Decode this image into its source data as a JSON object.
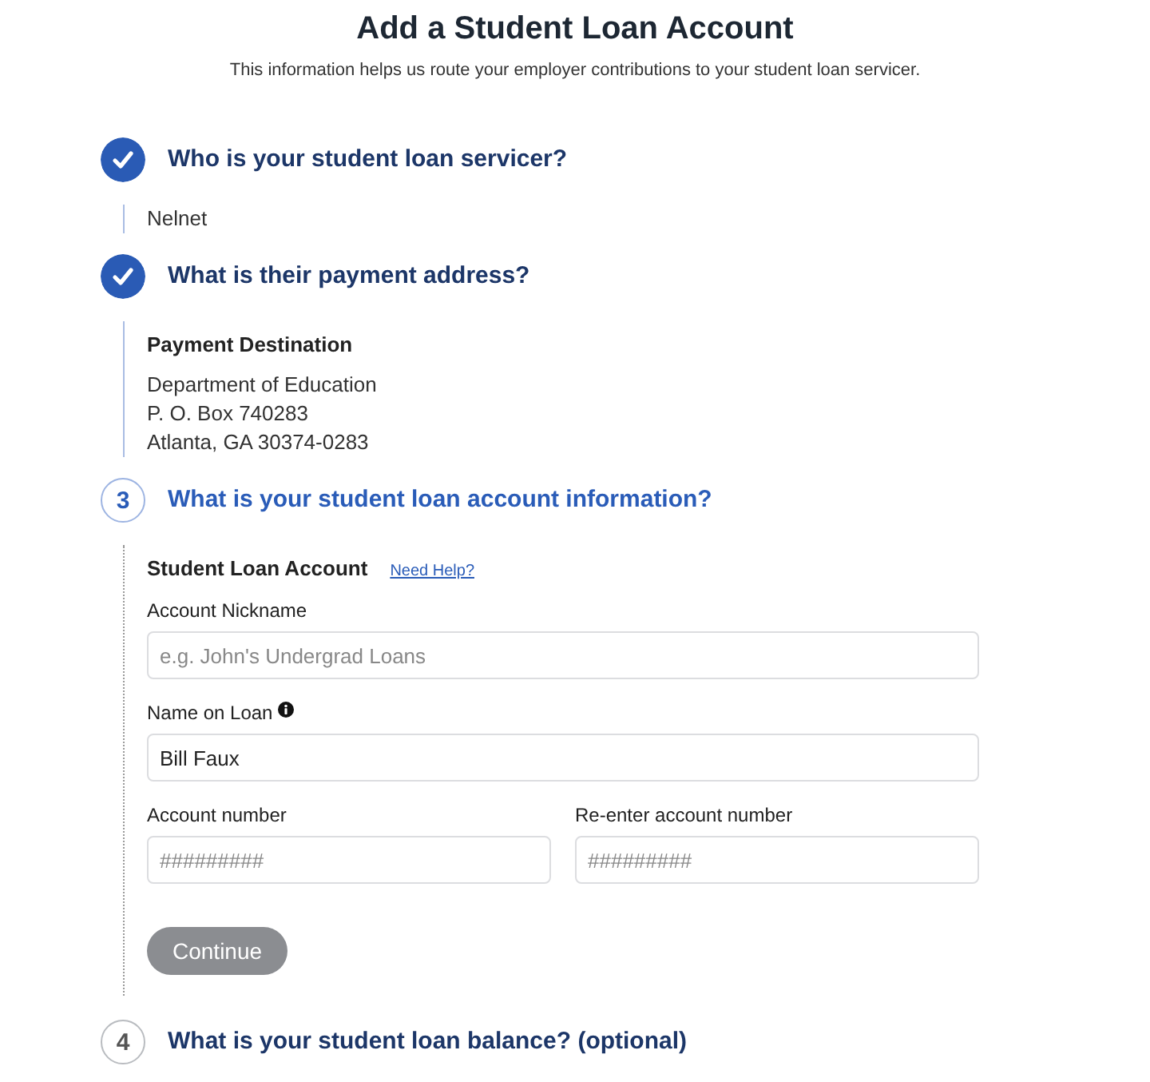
{
  "title": "Add a Student Loan Account",
  "subtitle": "This information helps us route your employer contributions to your student loan servicer.",
  "steps": [
    {
      "completed": true,
      "selected": false,
      "heading": "Who is your student loan servicer?",
      "summary": {
        "kind": "text",
        "text": "Nelnet"
      }
    },
    {
      "completed": true,
      "selected": false,
      "heading": "What is their payment address?",
      "summary": {
        "kind": "address",
        "label": "Payment Destination",
        "lines": [
          "Department of Education",
          "P. O. Box 740283",
          "Atlanta, GA 30374-0283"
        ]
      }
    },
    {
      "completed": false,
      "selected": true,
      "number": "3",
      "heading": "What is your student loan account information?",
      "form": {
        "title": "Student Loan Account",
        "help_link": "Need Help?",
        "rows": [
          {
            "fields": [
              {
                "label": "Account Nickname",
                "info": false,
                "placeholder": "e.g. John's Undergrad Loans"
              }
            ]
          },
          {
            "fields": [
              {
                "label": "Name on Loan",
                "info": true,
                "value": "Bill Faux"
              }
            ]
          },
          {
            "fields": [
              {
                "label": "Account number",
                "info": false,
                "placeholder": "#########"
              },
              {
                "label": "Re-enter account number",
                "info": false,
                "placeholder": "#########"
              }
            ]
          }
        ],
        "button": {
          "label": "Continue",
          "disabled": true
        }
      }
    },
    {
      "completed": false,
      "selected": false,
      "number": "4",
      "heading": "What is your student loan balance? (optional)"
    }
  ]
}
